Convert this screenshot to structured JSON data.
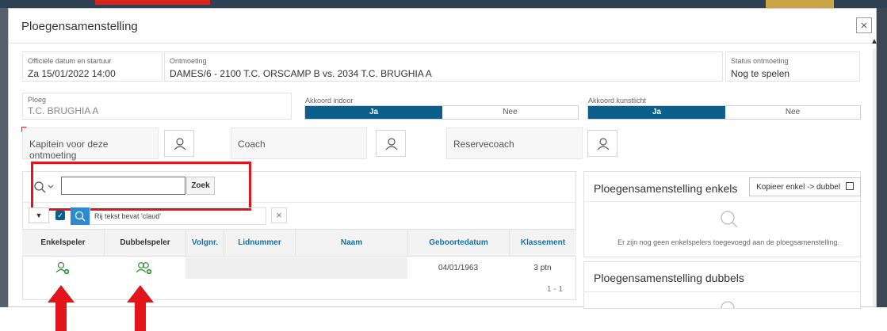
{
  "modal": {
    "title": "Ploegensamenstelling",
    "close": "×"
  },
  "fields": {
    "datum_label": "Officiële datum en startuur",
    "datum_value": "Za 15/01/2022 14:00",
    "ontmoeting_label": "Ontmoeting",
    "ontmoeting_value": "DAMES/6 - 2100 T.C. ORSCAMP B vs. 2034 T.C. BRUGHIA A",
    "status_label": "Status ontmoeting",
    "status_value": "Nog te spelen",
    "ploeg_label": "Ploeg",
    "ploeg_value": "T.C. BRUGHIA A",
    "indoor_label": "Akkoord indoor",
    "indoor_yes": "Ja",
    "indoor_no": "Nee",
    "kunstlicht_label": "Akkoord kunstlicht",
    "kunstlicht_yes": "Ja",
    "kunstlicht_no": "Nee"
  },
  "roles": {
    "kapitein": "Kapitein voor deze ontmoeting",
    "coach": "Coach",
    "reservecoach": "Reservecoach"
  },
  "search": {
    "button": "Zoek",
    "input_value": ""
  },
  "filter": {
    "dropdown": "▼",
    "checkbox": "✓",
    "text": "Rij tekst bevat 'claud'",
    "clear": "×"
  },
  "table": {
    "headers": {
      "enkelspeler": "Enkelspeler",
      "dubbelspeler": "Dubbelspeler",
      "volgnr": "Volgnr.",
      "lidnummer": "Lidnummer",
      "naam": "Naam",
      "geboortedatum": "Geboortedatum",
      "klassement": "Klassement"
    },
    "row": {
      "geboortedatum": "04/01/1963",
      "klassement": "3 ptn"
    },
    "pager": "1 - 1"
  },
  "side": {
    "enkels_title": "Ploegensamenstelling enkels",
    "kopieer_label": "Kopieer enkel -> dubbel",
    "empty_text": "Er zijn nog geen enkelspelers toegevoegd aan de ploegsamenstelling.",
    "dubbels_title": "Ploegensamenstelling dubbels"
  },
  "colors": {
    "accent": "#0c5f8d",
    "link": "#1c6fa3",
    "highlight": "#e3141a",
    "add_icon": "#2e8b3a"
  }
}
